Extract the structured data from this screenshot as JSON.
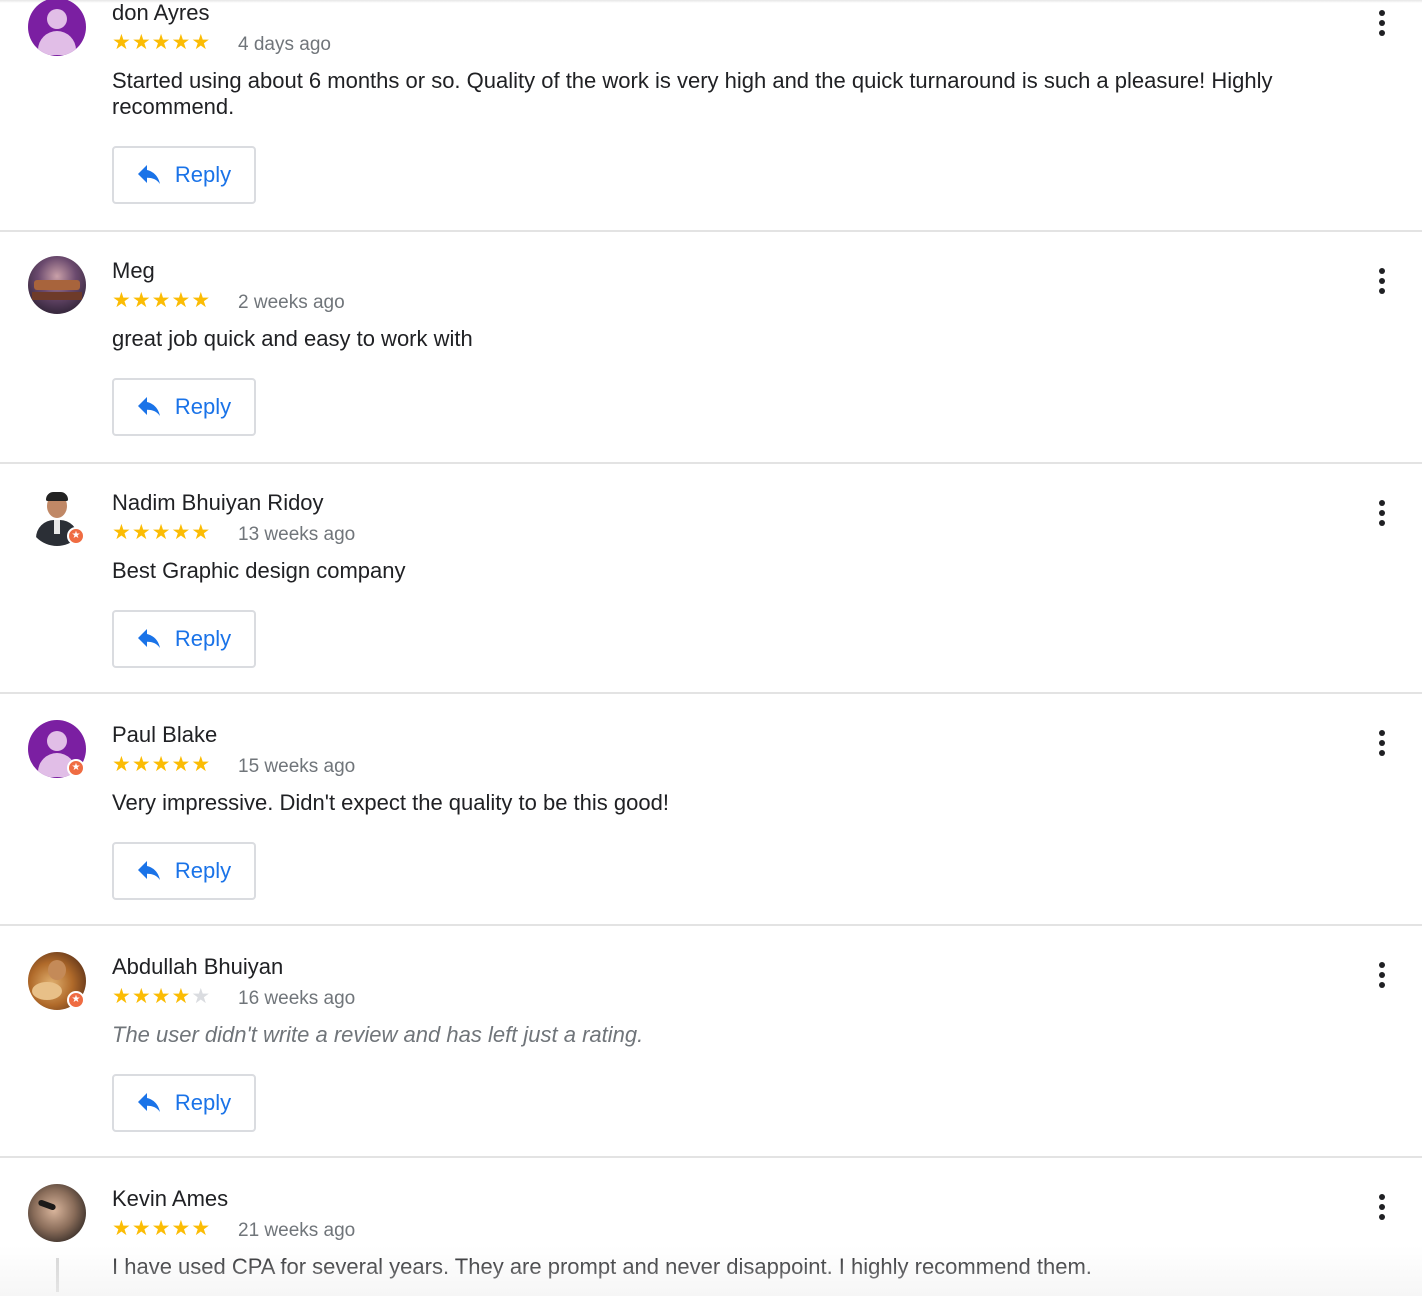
{
  "reviews": [
    {
      "name": "don Ayres",
      "rating": 5,
      "time": "4 days ago",
      "text": "Started using about 6 months or so. Quality of the work is very high and the quick turnaround is such a pleasure! Highly recommend.",
      "reply_label": "Reply",
      "avatar": "default-purple",
      "badge": false
    },
    {
      "name": "Meg",
      "rating": 5,
      "time": "2 weeks ago",
      "text": "great job quick and easy to work with",
      "reply_label": "Reply",
      "avatar": "photo",
      "badge": false
    },
    {
      "name": "Nadim Bhuiyan Ridoy",
      "rating": 5,
      "time": "13 weeks ago",
      "text": "Best Graphic design company",
      "reply_label": "Reply",
      "avatar": "photo",
      "badge": true
    },
    {
      "name": "Paul Blake",
      "rating": 5,
      "time": "15 weeks ago",
      "text": "Very impressive. Didn't expect the quality to be this good!",
      "reply_label": "Reply",
      "avatar": "default-purple",
      "badge": true
    },
    {
      "name": "Abdullah Bhuiyan",
      "rating": 4,
      "time": "16 weeks ago",
      "text": "The user didn't write a review and has left just a rating.",
      "reply_label": "Reply",
      "avatar": "photo",
      "badge": true,
      "no_review": true
    },
    {
      "name": "Kevin Ames",
      "rating": 5,
      "time": "21 weeks ago",
      "text": "I have used CPA for several years. They are prompt and never disappoint. I highly recommend them.",
      "reply_label": "",
      "avatar": "photo",
      "badge": false
    }
  ],
  "colors": {
    "star": "#fbbc04",
    "star_empty": "#dadce0",
    "reply": "#1a73e8",
    "avatar_default": "#7b1fa2",
    "badge": "#ef6c42"
  },
  "icons": {
    "reply": "reply-arrow-icon",
    "menu": "more-vert-icon",
    "star": "star-icon",
    "badge": "local-guide-badge-icon"
  }
}
